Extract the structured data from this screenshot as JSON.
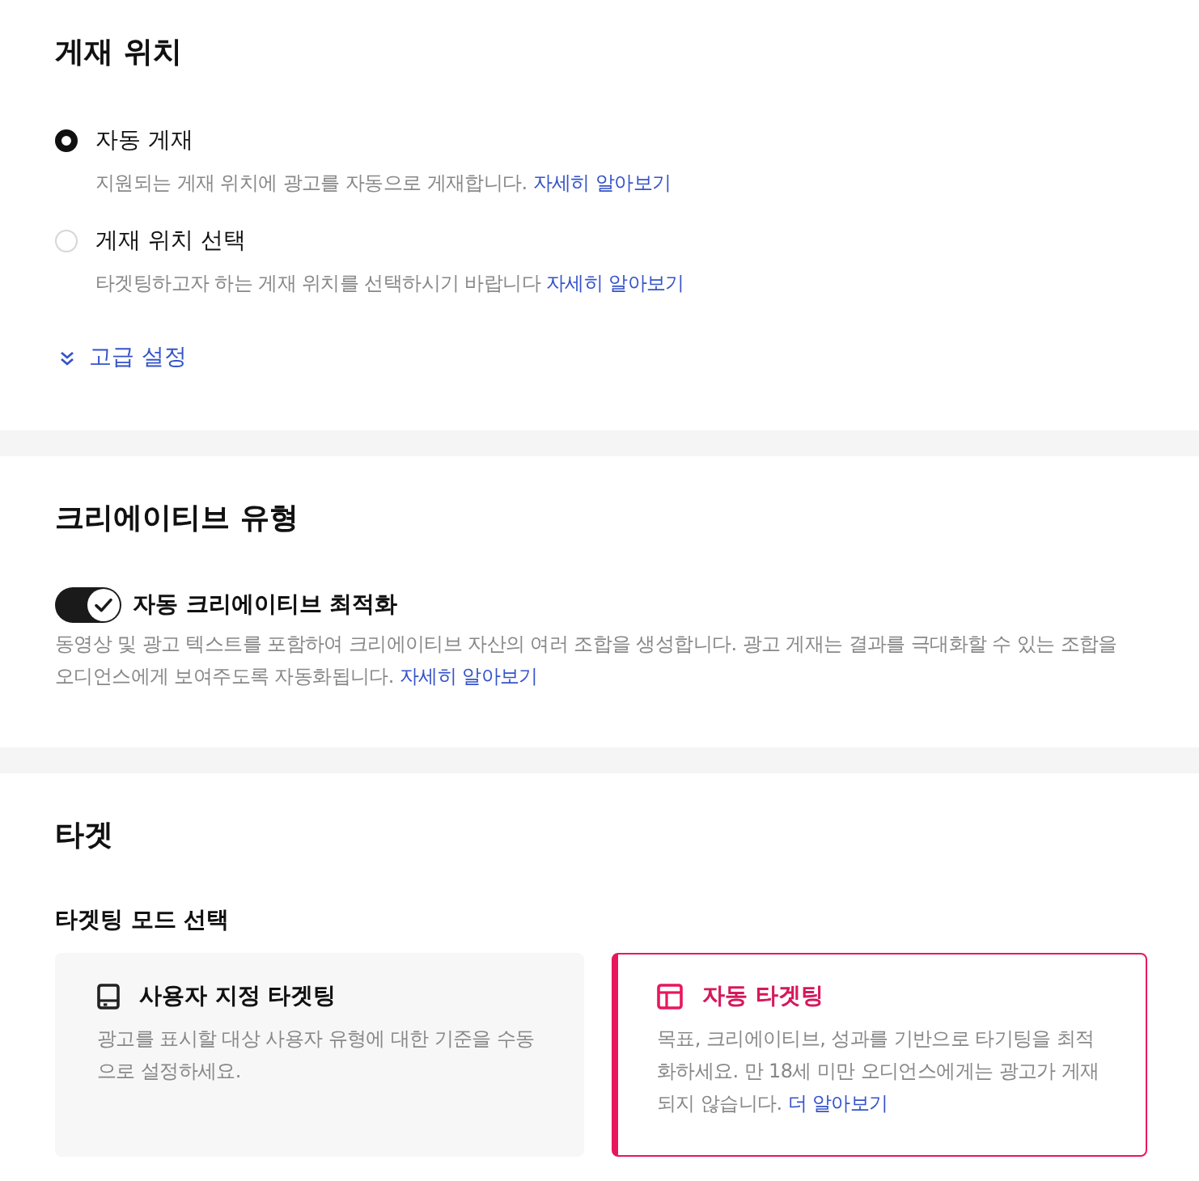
{
  "placement": {
    "title": "게재 위치",
    "options": [
      {
        "label": "자동 게재",
        "description": "지원되는 게재 위치에 광고를 자동으로 게재합니다.",
        "link": "자세히 알아보기",
        "selected": true
      },
      {
        "label": "게재 위치 선택",
        "description": "타겟팅하고자 하는 게재 위치를 선택하시기 바랍니다",
        "link": "자세히 알아보기",
        "selected": false
      }
    ],
    "advanced": {
      "label": "고급 설정",
      "expanded": false
    }
  },
  "creative_type": {
    "title": "크리에이티브 유형",
    "toggle": {
      "label": "자동 크리에이티브 최적화",
      "on": true
    },
    "description": "동영상 및 광고 텍스트를 포함하여 크리에이티브 자산의 여러 조합을 생성합니다. 광고 게재는 결과를 극대화할 수 있는 조합을 오디언스에게 보여주도록 자동화됩니다.",
    "link": "자세히 알아보기"
  },
  "target": {
    "title": "타겟",
    "mode_heading": "타겟팅 모드 선택",
    "modes": [
      {
        "kind": "custom",
        "title": "사용자 지정 타겟팅",
        "description": "광고를 표시할 대상 사용자 유형에 대한 기준을 수동으로 설정하세요.",
        "selected": false
      },
      {
        "kind": "auto",
        "title": "자동 타겟팅",
        "description": "목표, 크리에이티브, 성과를 기반으로 타기팅을 최적화하세요. 만 18세 미만 오디언스에게는 광고가 게재되지 않습니다.",
        "link": "더 알아보기",
        "selected": true
      }
    ]
  }
}
